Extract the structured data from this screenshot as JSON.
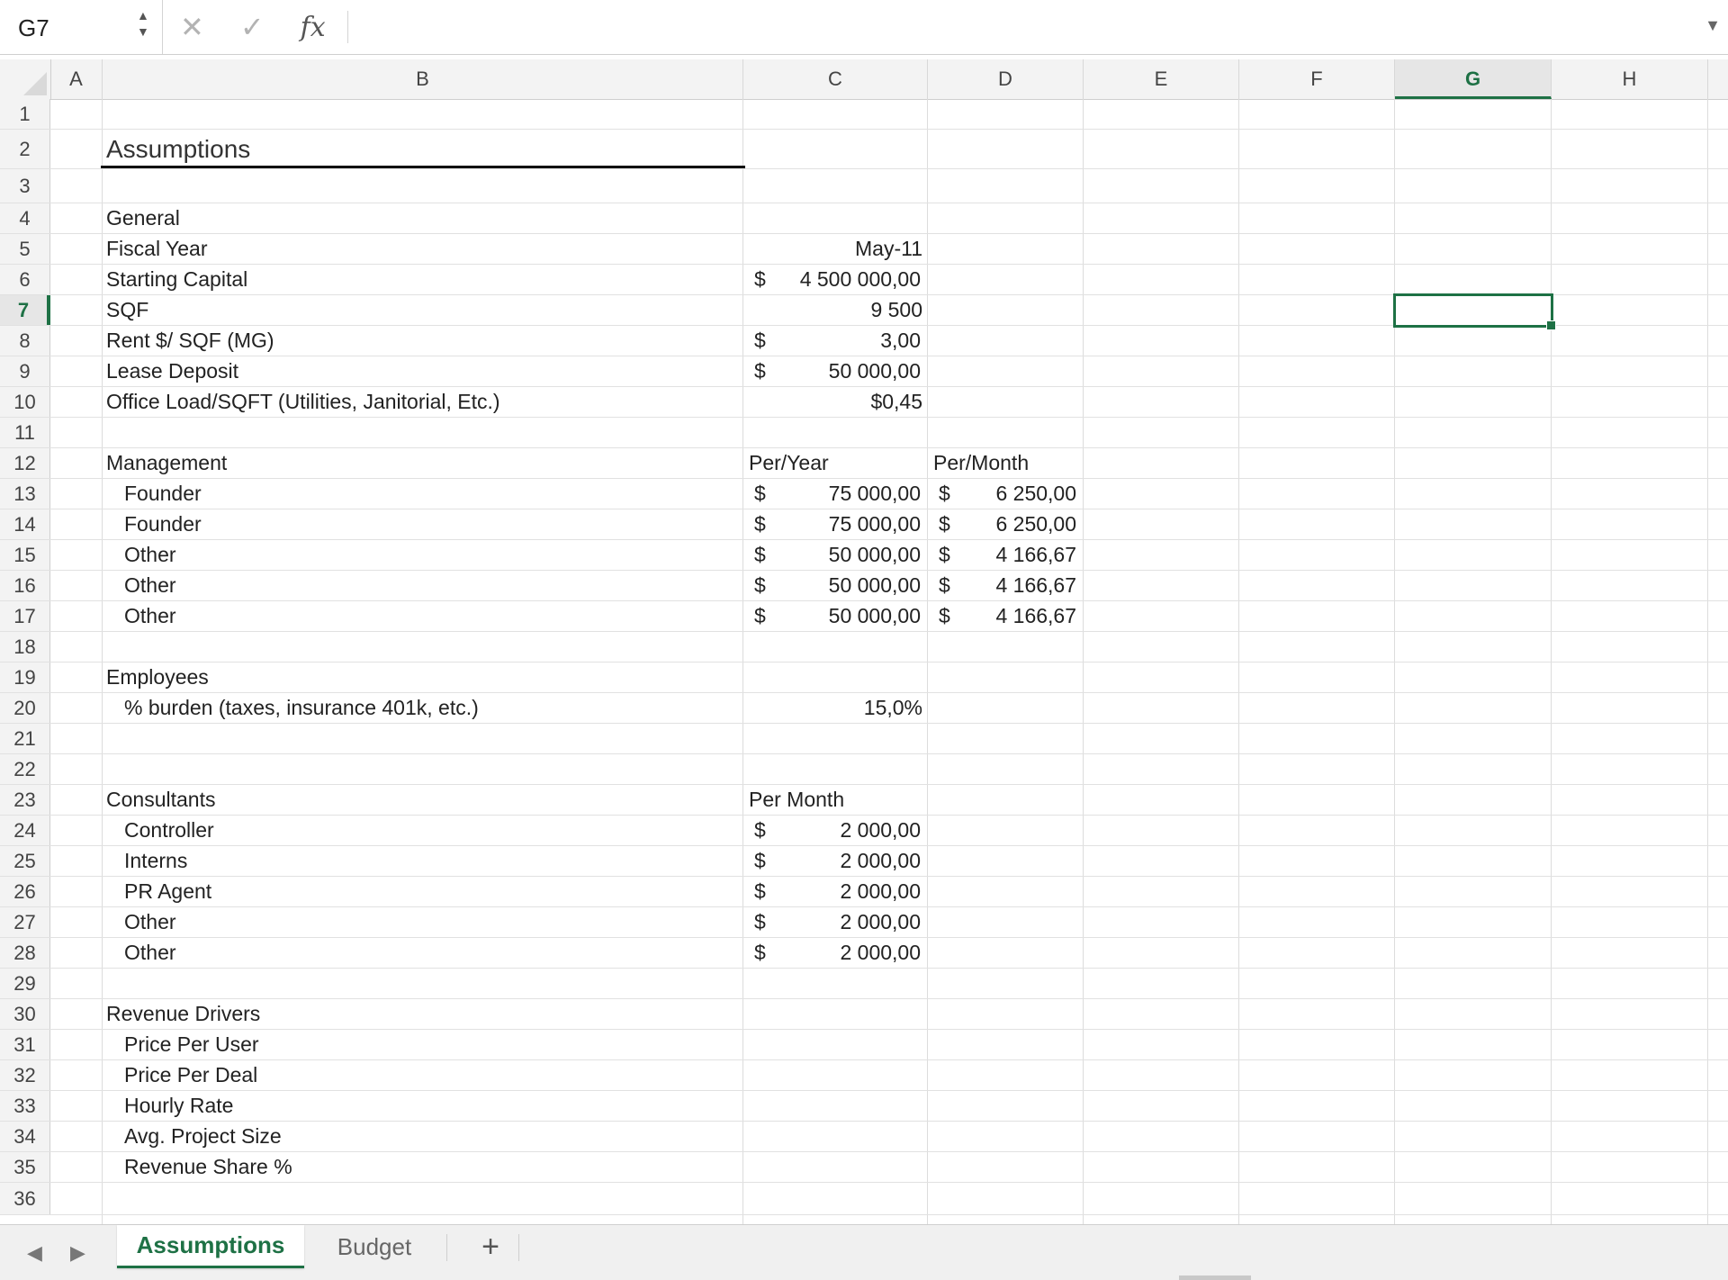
{
  "formula_bar": {
    "name_box": "G7",
    "stepper_up": "▲",
    "stepper_down": "▼",
    "cancel_icon": "✕",
    "confirm_icon": "✓",
    "fx_icon": "fx",
    "formula": "",
    "dropdown_icon": "▼"
  },
  "columns": [
    "A",
    "B",
    "C",
    "D",
    "E",
    "F",
    "G",
    "H"
  ],
  "active_column": "G",
  "active_row": "7",
  "row_numbers": [
    "1",
    "2",
    "3",
    "4",
    "5",
    "6",
    "7",
    "8",
    "9",
    "10",
    "11",
    "12",
    "13",
    "14",
    "15",
    "16",
    "17",
    "18",
    "19",
    "20",
    "21",
    "22",
    "23",
    "24",
    "25",
    "26",
    "27",
    "28",
    "29",
    "30",
    "31",
    "32",
    "33",
    "34",
    "35",
    "36"
  ],
  "cells": {
    "r2": {
      "b": "Assumptions"
    },
    "r4": {
      "b": "General"
    },
    "r5": {
      "b": "Fiscal Year",
      "c": "May-11"
    },
    "r6": {
      "b": "Starting Capital",
      "c_cur": "$",
      "c_amt": "4 500 000,00"
    },
    "r7": {
      "b": "SQF",
      "c": "9 500"
    },
    "r8": {
      "b": "Rent $/ SQF (MG)",
      "c_cur": "$",
      "c_amt": "3,00"
    },
    "r9": {
      "b": "Lease Deposit",
      "c_cur": "$",
      "c_amt": "50 000,00"
    },
    "r10": {
      "b": "Office Load/SQFT (Utilities, Janitorial, Etc.)",
      "c": "$0,45"
    },
    "r12": {
      "b": "Management",
      "c": "Per/Year",
      "d": "Per/Month"
    },
    "r13": {
      "b": "Founder",
      "c_cur": "$",
      "c_amt": "75 000,00",
      "d_cur": "$",
      "d_amt": "6 250,00"
    },
    "r14": {
      "b": "Founder",
      "c_cur": "$",
      "c_amt": "75 000,00",
      "d_cur": "$",
      "d_amt": "6 250,00"
    },
    "r15": {
      "b": "Other",
      "c_cur": "$",
      "c_amt": "50 000,00",
      "d_cur": "$",
      "d_amt": "4 166,67"
    },
    "r16": {
      "b": "Other",
      "c_cur": "$",
      "c_amt": "50 000,00",
      "d_cur": "$",
      "d_amt": "4 166,67"
    },
    "r17": {
      "b": "Other",
      "c_cur": "$",
      "c_amt": "50 000,00",
      "d_cur": "$",
      "d_amt": "4 166,67"
    },
    "r19": {
      "b": "Employees"
    },
    "r20": {
      "b": "% burden (taxes, insurance 401k, etc.)",
      "c": "15,0%"
    },
    "r23": {
      "b": "Consultants",
      "c": "Per Month"
    },
    "r24": {
      "b": "Controller",
      "c_cur": "$",
      "c_amt": "2 000,00"
    },
    "r25": {
      "b": "Interns",
      "c_cur": "$",
      "c_amt": "2 000,00"
    },
    "r26": {
      "b": "PR Agent",
      "c_cur": "$",
      "c_amt": "2 000,00"
    },
    "r27": {
      "b": "Other",
      "c_cur": "$",
      "c_amt": "2 000,00"
    },
    "r28": {
      "b": "Other",
      "c_cur": "$",
      "c_amt": "2 000,00"
    },
    "r30": {
      "b": "Revenue Drivers"
    },
    "r31": {
      "b": "Price Per User"
    },
    "r32": {
      "b": "Price Per Deal"
    },
    "r33": {
      "b": "Hourly Rate"
    },
    "r34": {
      "b": "Avg. Project Size"
    },
    "r35": {
      "b": "Revenue Share %"
    }
  },
  "tabs": {
    "prev_icon": "◀",
    "next_icon": "▶",
    "sheet1": "Assumptions",
    "sheet2": "Budget",
    "add": "+"
  },
  "colors": {
    "accent": "#1e7145"
  }
}
